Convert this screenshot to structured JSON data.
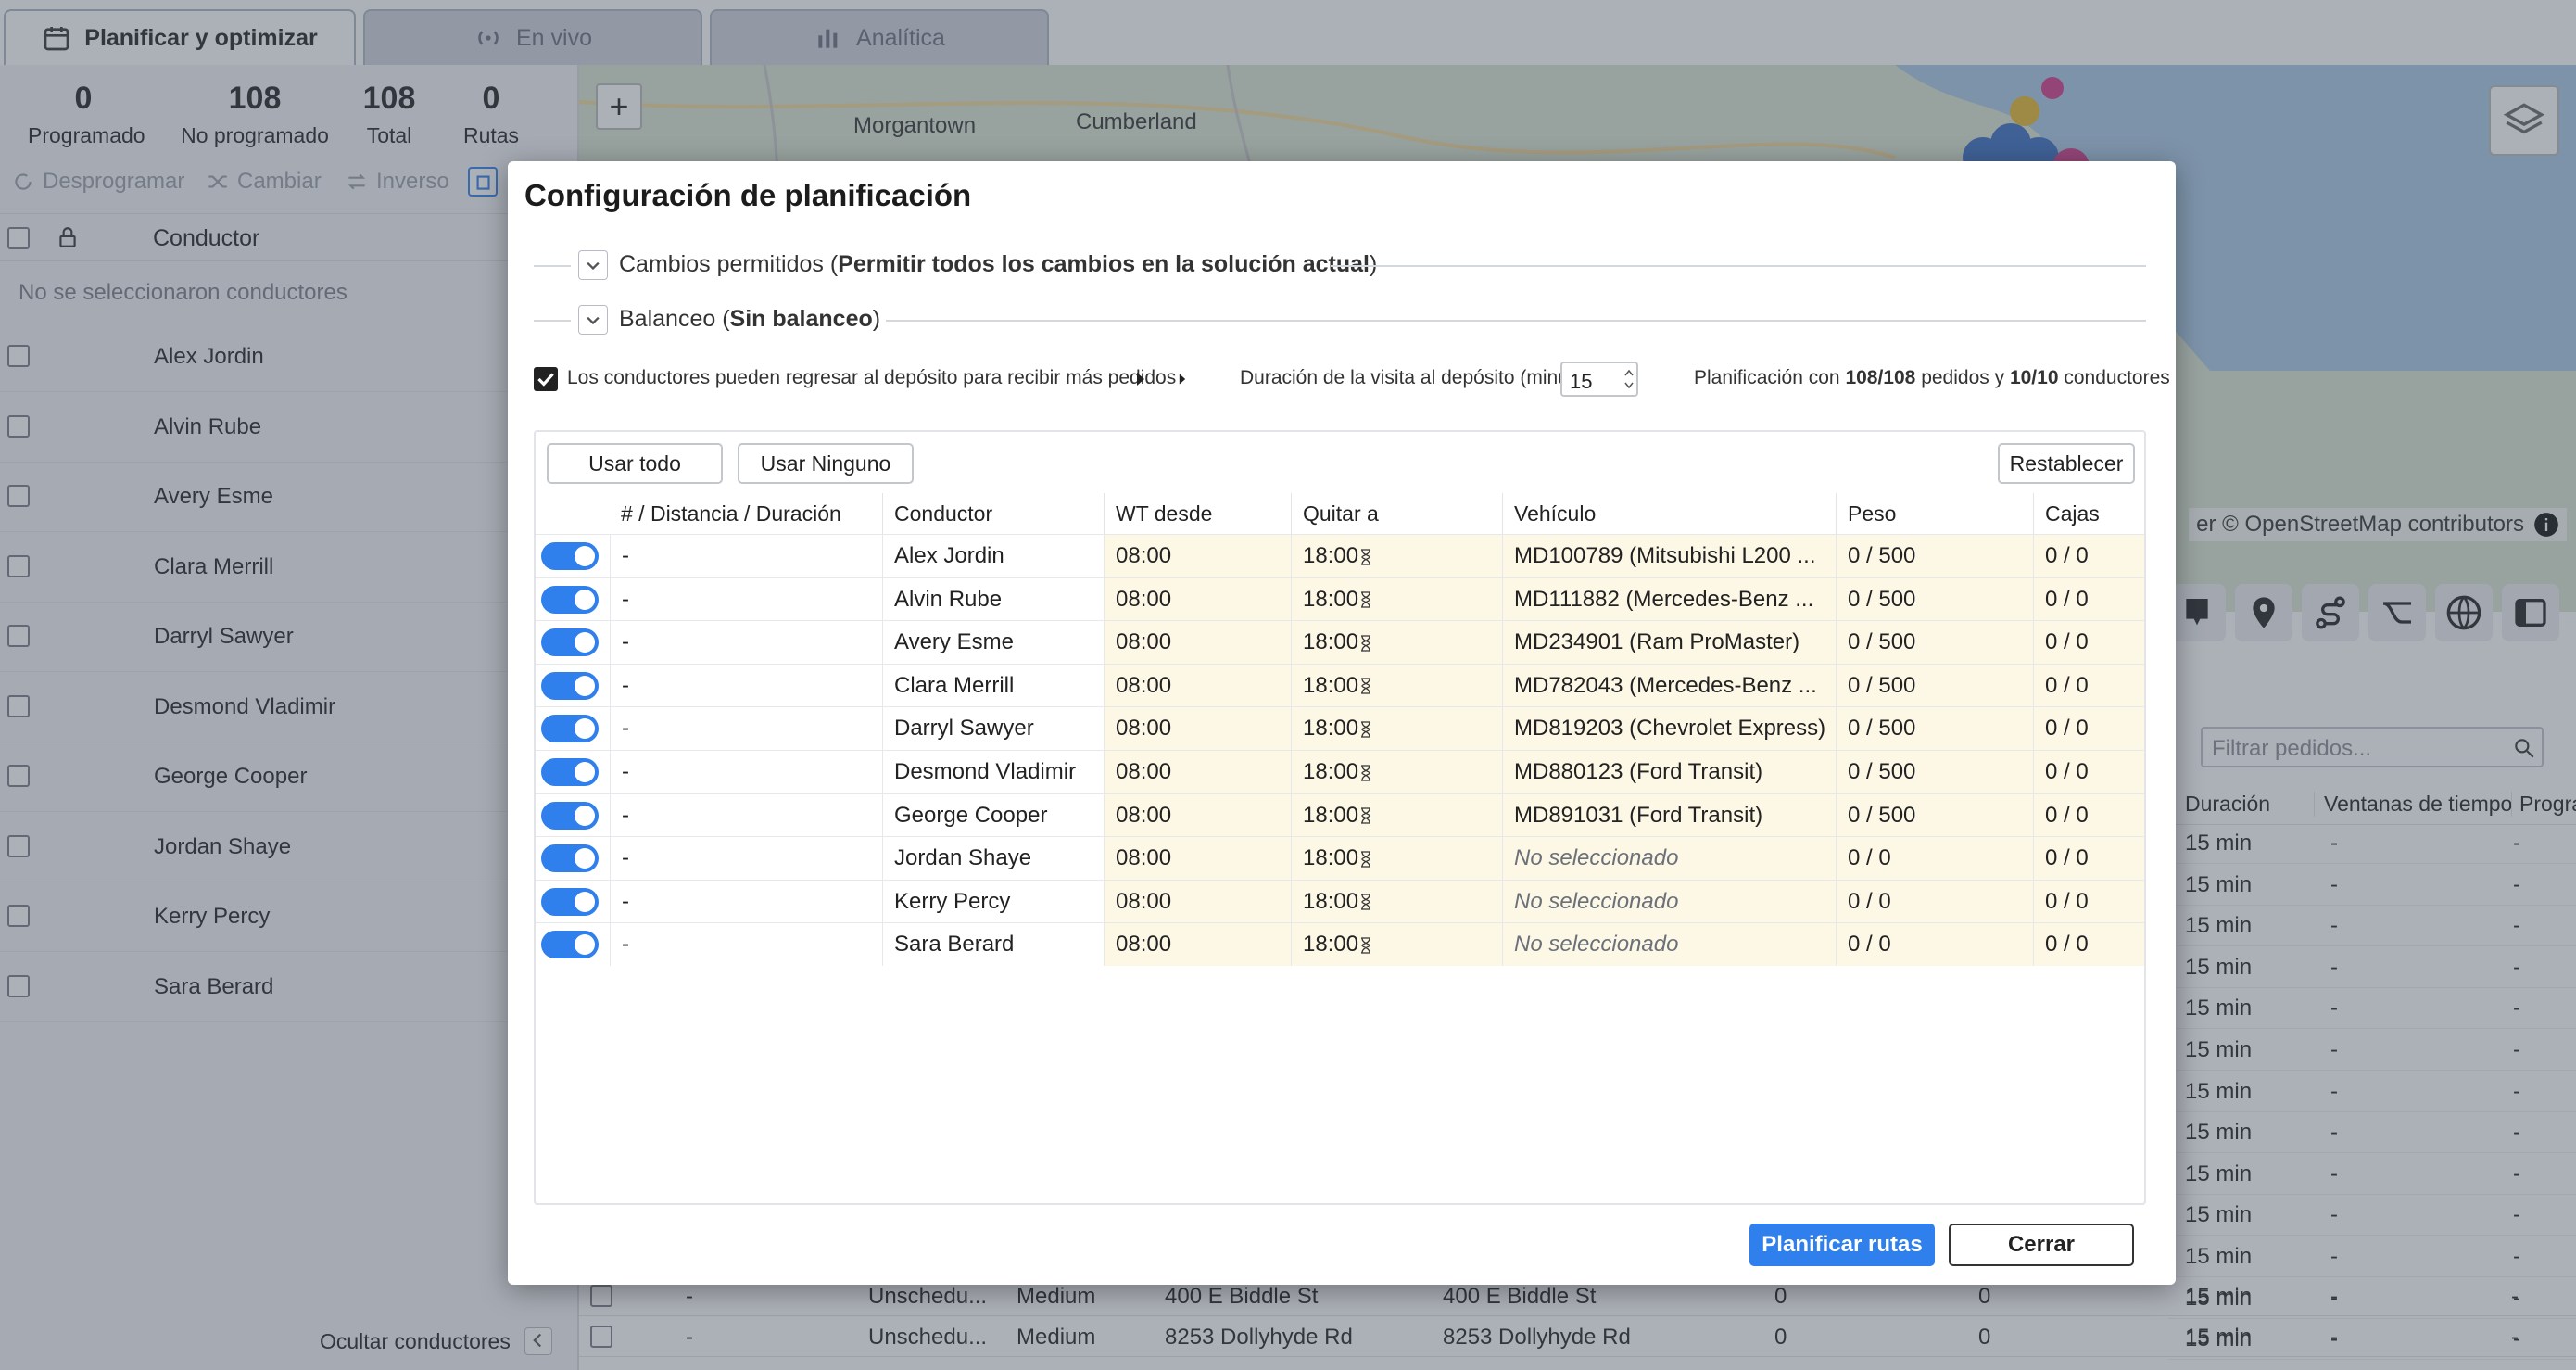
{
  "tabs": [
    {
      "label": "Planificar y optimizar",
      "icon": "calendar-icon"
    },
    {
      "label": "En vivo",
      "icon": "broadcast-icon"
    },
    {
      "label": "Analítica",
      "icon": "bar-chart-icon"
    }
  ],
  "stats": [
    {
      "value": "0",
      "label": "Programado"
    },
    {
      "value": "108",
      "label": "No programado"
    },
    {
      "value": "108",
      "label": "Total"
    },
    {
      "value": "0",
      "label": "Rutas"
    }
  ],
  "toolbar": {
    "unschedule": "Desprogramar",
    "change": "Cambiar",
    "reverse": "Inverso"
  },
  "drivers_panel": {
    "header": "Conductor",
    "empty": "No se seleccionaron conductores",
    "hide": "Ocultar conductores",
    "items": [
      "Alex Jordin",
      "Alvin Rube",
      "Avery Esme",
      "Clara Merrill",
      "Darryl Sawyer",
      "Desmond Vladimir",
      "George Cooper",
      "Jordan Shaye",
      "Kerry Percy",
      "Sara Berard"
    ]
  },
  "map": {
    "cities": [
      "Morgantown",
      "Cumberland"
    ],
    "attribution": "er © OpenStreetMap contributors",
    "zoom_in": "+"
  },
  "orders": {
    "filter_placeholder": "Filtrar pedidos...",
    "headers": [
      "Duración",
      "Ventanas de tiempo",
      "Progra"
    ],
    "durations": [
      "15 min",
      "15 min",
      "15 min",
      "15 min",
      "15 min",
      "15 min",
      "15 min",
      "15 min",
      "15 min",
      "15 min",
      "15 min",
      "15 min",
      "15 min"
    ],
    "dash": "-",
    "bottom_rows": [
      {
        "status": "Unschedu...",
        "priority": "Medium",
        "address1": "400 E Biddle St",
        "address2": "400 E Biddle St",
        "v1": "0",
        "v2": "0",
        "dur": "15 min"
      },
      {
        "status": "Unschedu...",
        "priority": "Medium",
        "address1": "8253 Dollyhyde Rd",
        "address2": "8253 Dollyhyde Rd",
        "v1": "0",
        "v2": "0",
        "dur": "15 min"
      }
    ]
  },
  "dialog": {
    "title": "Configuración de planificación",
    "section1": {
      "label": "Cambios permitidos",
      "value": "Permitir todos los cambios en la solución actual"
    },
    "section2": {
      "label": "Balanceo",
      "value": "Sin balanceo"
    },
    "depot_option": "Los conductores pueden regresar al depósito para recibir más pedidos",
    "visit_label": "Duración de la visita al depósito (minutos):",
    "visit_value": "15",
    "summary": {
      "pre": "Planificación con",
      "orders": "108/108",
      "mid": "pedidos y",
      "drivers": "10/10",
      "post": "conductores"
    },
    "use_all": "Usar todo",
    "use_none": "Usar Ninguno",
    "reset": "Restablecer",
    "columns": [
      "# / Distancia / Duración",
      "Conductor",
      "WT desde",
      "Quitar a",
      "Vehículo",
      "Peso",
      "Cajas"
    ],
    "rows": [
      {
        "num": "-",
        "driver": "Alex Jordin",
        "from": "08:00",
        "to": "18:00",
        "vehicle": "MD100789 (Mitsubishi L200 ...",
        "weight": "0 / 500",
        "boxes": "0 / 0"
      },
      {
        "num": "-",
        "driver": "Alvin Rube",
        "from": "08:00",
        "to": "18:00",
        "vehicle": "MD111882 (Mercedes-Benz ...",
        "weight": "0 / 500",
        "boxes": "0 / 0"
      },
      {
        "num": "-",
        "driver": "Avery Esme",
        "from": "08:00",
        "to": "18:00",
        "vehicle": "MD234901 (Ram ProMaster)",
        "weight": "0 / 500",
        "boxes": "0 / 0"
      },
      {
        "num": "-",
        "driver": "Clara Merrill",
        "from": "08:00",
        "to": "18:00",
        "vehicle": "MD782043 (Mercedes-Benz ...",
        "weight": "0 / 500",
        "boxes": "0 / 0"
      },
      {
        "num": "-",
        "driver": "Darryl Sawyer",
        "from": "08:00",
        "to": "18:00",
        "vehicle": "MD819203 (Chevrolet Express)",
        "weight": "0 / 500",
        "boxes": "0 / 0"
      },
      {
        "num": "-",
        "driver": "Desmond Vladimir",
        "from": "08:00",
        "to": "18:00",
        "vehicle": "MD880123 (Ford Transit)",
        "weight": "0 / 500",
        "boxes": "0 / 0"
      },
      {
        "num": "-",
        "driver": "George Cooper",
        "from": "08:00",
        "to": "18:00",
        "vehicle": "MD891031 (Ford Transit)",
        "weight": "0 / 500",
        "boxes": "0 / 0"
      },
      {
        "num": "-",
        "driver": "Jordan Shaye",
        "from": "08:00",
        "to": "18:00",
        "vehicle": "No seleccionado",
        "weight": "0 / 0",
        "boxes": "0 / 0"
      },
      {
        "num": "-",
        "driver": "Kerry Percy",
        "from": "08:00",
        "to": "18:00",
        "vehicle": "No seleccionado",
        "weight": "0 / 0",
        "boxes": "0 / 0"
      },
      {
        "num": "-",
        "driver": "Sara Berard",
        "from": "08:00",
        "to": "18:00",
        "vehicle": "No seleccionado",
        "weight": "0 / 0",
        "boxes": "0 / 0"
      }
    ],
    "plan_button": "Planificar rutas",
    "close_button": "Cerrar"
  },
  "colors": {
    "accent": "#2f80ed",
    "highlight": "#fdf7e6"
  }
}
